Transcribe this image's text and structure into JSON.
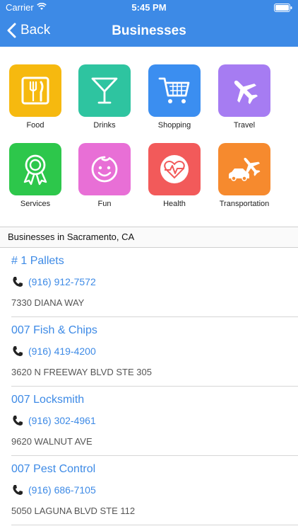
{
  "status_bar": {
    "carrier": "Carrier",
    "time": "5:45 PM",
    "wifi_icon": "wifi-icon",
    "battery_icon": "battery-icon"
  },
  "nav": {
    "back_label": "Back",
    "title": "Businesses",
    "color": "#3d8ae6"
  },
  "categories": [
    {
      "label": "Food",
      "icon": "fork-knife-icon",
      "color": "#f6b90f"
    },
    {
      "label": "Drinks",
      "icon": "martini-glass-icon",
      "color": "#2ec4a0"
    },
    {
      "label": "Shopping",
      "icon": "shopping-cart-icon",
      "color": "#3b8ef0"
    },
    {
      "label": "Travel",
      "icon": "airplane-icon",
      "color": "#a67cf2"
    },
    {
      "label": "Services",
      "icon": "ribbon-badge-icon",
      "color": "#2dc74b"
    },
    {
      "label": "Fun",
      "icon": "smiley-face-icon",
      "color": "#e86fd6"
    },
    {
      "label": "Health",
      "icon": "heart-monitor-icon",
      "color": "#f25a5a"
    },
    {
      "label": "Transportation",
      "icon": "car-plane-icon",
      "color": "#f68a2e"
    }
  ],
  "section": {
    "title": "Businesses in Sacramento, CA"
  },
  "businesses": [
    {
      "name": "# 1 Pallets",
      "phone": "(916) 912-7572",
      "address": "7330 DIANA WAY"
    },
    {
      "name": "007 Fish & Chips",
      "phone": "(916) 419-4200",
      "address": "3620 N FREEWAY BLVD STE 305"
    },
    {
      "name": "007 Locksmith",
      "phone": "(916) 302-4961",
      "address": "9620 WALNUT AVE"
    },
    {
      "name": "007 Pest Control",
      "phone": "(916) 686-7105",
      "address": "5050 LAGUNA BLVD STE 112"
    }
  ]
}
